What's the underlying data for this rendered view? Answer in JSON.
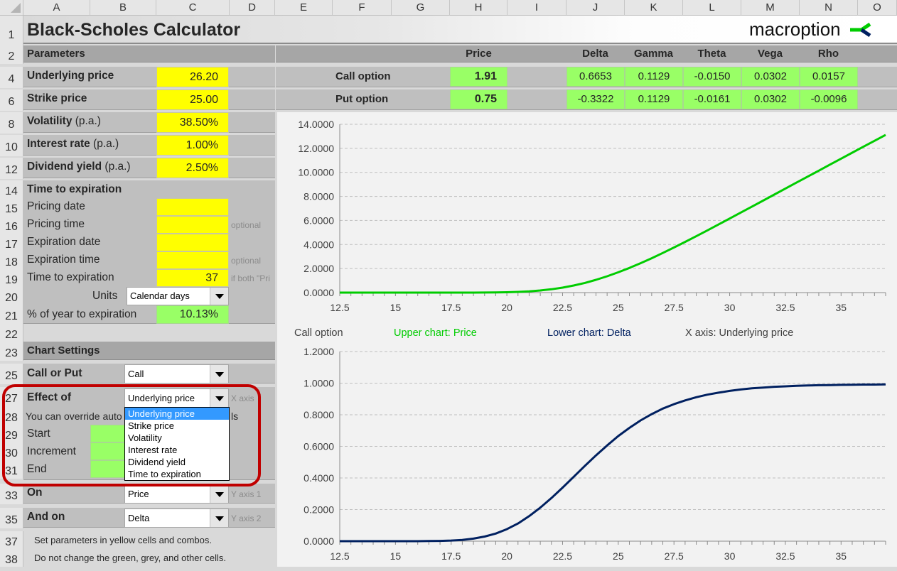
{
  "columns": [
    "A",
    "B",
    "C",
    "D",
    "E",
    "F",
    "G",
    "H",
    "I",
    "J",
    "K",
    "L",
    "M",
    "N",
    "O"
  ],
  "rows": [
    "1",
    "2",
    "4",
    "6",
    "8",
    "10",
    "12",
    "14",
    "15",
    "16",
    "17",
    "18",
    "19",
    "20",
    "21",
    "22",
    "23",
    "25",
    "27",
    "28",
    "29",
    "30",
    "31",
    "33",
    "35",
    "37",
    "38"
  ],
  "title": "Black-Scholes Calculator",
  "logo": {
    "text": "macroption",
    "icon": "macroption-logo-icon"
  },
  "parameters": {
    "header": "Parameters",
    "underlying_price": {
      "label": "Underlying price",
      "value": "26.20"
    },
    "strike_price": {
      "label": "Strike price",
      "value": "25.00"
    },
    "volatility": {
      "label": "Volatility",
      "suffix": "(p.a.)",
      "value": "38.50%"
    },
    "interest_rate": {
      "label": "Interest rate",
      "suffix": "(p.a.)",
      "value": "1.00%"
    },
    "dividend_yield": {
      "label": "Dividend yield",
      "suffix": "(p.a.)",
      "value": "2.50%"
    }
  },
  "time": {
    "header": "Time to expiration",
    "pricing_date": {
      "label": "Pricing date",
      "value": ""
    },
    "pricing_time": {
      "label": "Pricing time",
      "value": "",
      "note": "optional"
    },
    "expiration_date": {
      "label": "Expiration date",
      "value": ""
    },
    "expiration_time": {
      "label": "Expiration time",
      "value": "",
      "note": "optional"
    },
    "time_to_expiration": {
      "label": "Time to expiration",
      "value": "37",
      "note": "if both \"Pri"
    },
    "units": {
      "label": "Units",
      "value": "Calendar days"
    },
    "pct_year": {
      "label": "% of year to expiration",
      "value": "10.13%"
    }
  },
  "results": {
    "headers": {
      "price": "Price",
      "delta": "Delta",
      "gamma": "Gamma",
      "theta": "Theta",
      "vega": "Vega",
      "rho": "Rho"
    },
    "call": {
      "label": "Call option",
      "price": "1.91",
      "delta": "0.6653",
      "gamma": "0.1129",
      "theta": "-0.0150",
      "vega": "0.0302",
      "rho": "0.0157"
    },
    "put": {
      "label": "Put option",
      "price": "0.75",
      "delta": "-0.3322",
      "gamma": "0.1129",
      "theta": "-0.0161",
      "vega": "0.0302",
      "rho": "-0.0096"
    }
  },
  "chart_settings": {
    "header": "Chart Settings",
    "call_or_put": {
      "label": "Call or Put",
      "value": "Call"
    },
    "effect_of": {
      "label": "Effect of",
      "value": "Underlying price",
      "note": "X axis",
      "options": [
        "Underlying price",
        "Strike price",
        "Volatility",
        "Interest rate",
        "Dividend yield",
        "Time to expiration"
      ],
      "selected_index": 0
    },
    "override_note": "You can override auto",
    "override_note_tail": "ls",
    "start": {
      "label": "Start",
      "value": ""
    },
    "increment": {
      "label": "Increment",
      "value": ""
    },
    "end": {
      "label": "End",
      "value": ""
    },
    "on": {
      "label": "On",
      "value": "Price",
      "note": "Y axis 1"
    },
    "and_on": {
      "label": "And on",
      "value": "Delta",
      "note": "Y axis 2"
    }
  },
  "instructions": [
    "Set parameters in yellow cells and combos.",
    "Do not change the green, grey, and other cells."
  ],
  "chart_legend": {
    "option": "Call option",
    "upper": "Upper chart: Price",
    "lower": "Lower chart: Delta",
    "xaxis": "X axis: Underlying price"
  },
  "colors": {
    "yellow": "#ffff00",
    "green_cell": "#99ff66",
    "price_line": "#00cc00",
    "delta_line": "#002060",
    "highlight": "#c00000"
  },
  "chart_data": [
    {
      "type": "line",
      "title": "Upper chart: Price",
      "xlabel": "Underlying price",
      "ylabel": "Price",
      "x": [
        12.5,
        13,
        13.5,
        14,
        14.5,
        15,
        15.5,
        16,
        16.5,
        17,
        17.5,
        18,
        18.5,
        19,
        19.5,
        20,
        20.5,
        21,
        21.5,
        22,
        22.5,
        23,
        23.5,
        24,
        24.5,
        25,
        25.5,
        26,
        26.5,
        27,
        27.5,
        28,
        28.5,
        29,
        29.5,
        30,
        30.5,
        31,
        31.5,
        32,
        32.5,
        33,
        33.5,
        34,
        34.5,
        35,
        35.5,
        36,
        36.5,
        37
      ],
      "values": [
        0,
        0,
        0,
        0,
        0,
        0,
        0,
        0,
        0,
        0,
        0,
        0.001,
        0.002,
        0.006,
        0.014,
        0.03,
        0.058,
        0.105,
        0.176,
        0.277,
        0.414,
        0.59,
        0.806,
        1.062,
        1.357,
        1.688,
        2.051,
        2.443,
        2.859,
        3.296,
        3.749,
        4.215,
        4.691,
        5.175,
        5.665,
        6.159,
        6.655,
        7.153,
        7.652,
        8.151,
        8.65,
        9.149,
        9.647,
        10.145,
        10.643,
        11.14,
        11.636,
        12.131,
        12.626,
        13.12
      ],
      "xticks": [
        "12.5",
        "15",
        "17.5",
        "20",
        "22.5",
        "25",
        "27.5",
        "30",
        "32.5",
        "35"
      ],
      "yticks": [
        "0.0000",
        "2.0000",
        "4.0000",
        "6.0000",
        "8.0000",
        "10.0000",
        "12.0000",
        "14.0000"
      ],
      "ylim": [
        0,
        14
      ],
      "grid": true,
      "series_color": "#00cc00"
    },
    {
      "type": "line",
      "title": "Lower chart: Delta",
      "xlabel": "Underlying price",
      "ylabel": "Delta",
      "x": [
        12.5,
        13,
        13.5,
        14,
        14.5,
        15,
        15.5,
        16,
        16.5,
        17,
        17.5,
        18,
        18.5,
        19,
        19.5,
        20,
        20.5,
        21,
        21.5,
        22,
        22.5,
        23,
        23.5,
        24,
        24.5,
        25,
        25.5,
        26,
        26.5,
        27,
        27.5,
        28,
        28.5,
        29,
        29.5,
        30,
        30.5,
        31,
        31.5,
        32,
        32.5,
        33,
        33.5,
        34,
        34.5,
        35,
        35.5,
        36,
        36.5,
        37
      ],
      "values": [
        0,
        0,
        0,
        0,
        0,
        0,
        0,
        0,
        0.001,
        0.002,
        0.004,
        0.008,
        0.016,
        0.029,
        0.048,
        0.076,
        0.112,
        0.158,
        0.212,
        0.273,
        0.339,
        0.407,
        0.476,
        0.543,
        0.606,
        0.665,
        0.717,
        0.764,
        0.804,
        0.839,
        0.867,
        0.891,
        0.911,
        0.927,
        0.94,
        0.951,
        0.96,
        0.967,
        0.972,
        0.977,
        0.98,
        0.983,
        0.985,
        0.987,
        0.988,
        0.989,
        0.99,
        0.991,
        0.991,
        0.992
      ],
      "xticks": [
        "12.5",
        "15",
        "17.5",
        "20",
        "22.5",
        "25",
        "27.5",
        "30",
        "32.5",
        "35"
      ],
      "yticks": [
        "0.0000",
        "0.2000",
        "0.4000",
        "0.6000",
        "0.8000",
        "1.0000",
        "1.2000"
      ],
      "ylim": [
        0,
        1.2
      ],
      "grid": true,
      "series_color": "#002060"
    }
  ]
}
